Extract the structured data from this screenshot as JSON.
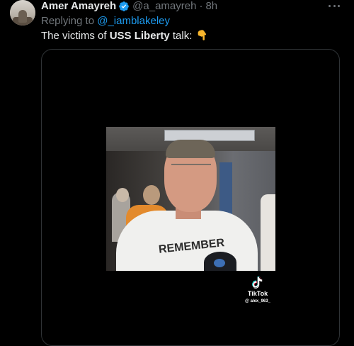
{
  "tweet": {
    "author_name": "Amer Amayreh",
    "author_handle": "@a_amayreh",
    "separator": "·",
    "timestamp": "8h",
    "verified_icon": "verified-badge-icon",
    "more_icon": "more-options-icon",
    "replying_prefix": "Replying to ",
    "replying_mention": "@_iamblakeley",
    "text_prefix": "The victims of ",
    "text_bold": "USS Liberty",
    "text_suffix": " talk: ",
    "emoji_icon": "backhand-index-pointing-down-icon"
  },
  "media": {
    "type": "video",
    "shirt_text": "REMEMBER",
    "watermark": {
      "brand": "TikTok",
      "username": "@ alex_963_"
    }
  },
  "colors": {
    "background": "#000000",
    "primary_text": "#e7e9ea",
    "secondary_text": "#71767b",
    "accent": "#1d9bf0",
    "border": "#2f3336"
  }
}
